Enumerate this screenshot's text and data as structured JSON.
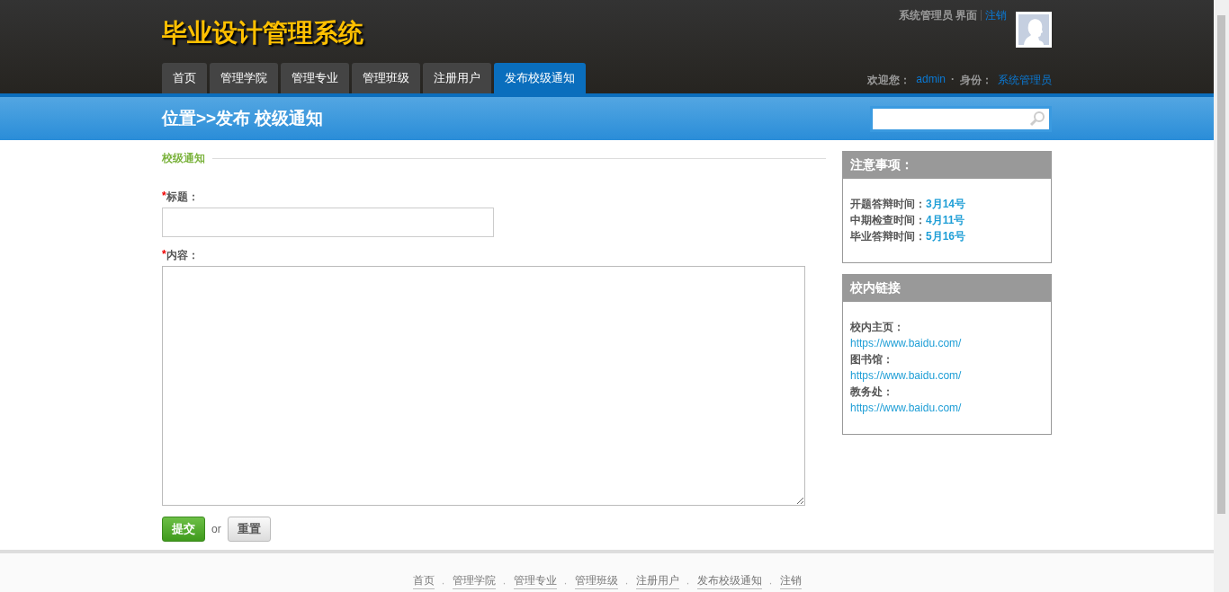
{
  "header": {
    "title": "毕业设计管理系统",
    "role_text": "系统管理员 界面",
    "logout": "注销",
    "welcome_label": "欢迎您：",
    "username": "admin",
    "separator": "·",
    "identity_label": "身份：",
    "identity_value": "系统管理员"
  },
  "nav_tabs": [
    {
      "label": "首页",
      "selected": false
    },
    {
      "label": "管理学院",
      "selected": false
    },
    {
      "label": "管理专业",
      "selected": false
    },
    {
      "label": "管理班级",
      "selected": false
    },
    {
      "label": "注册用户",
      "selected": false
    },
    {
      "label": "发布校级通知",
      "selected": true
    }
  ],
  "breadcrumb": "位置>>发布 校级通知",
  "form": {
    "legend": "校级通知",
    "fields": [
      {
        "kind": "input",
        "marker": "*",
        "label": "标题："
      },
      {
        "kind": "textarea",
        "marker": "*",
        "label": "内容："
      }
    ],
    "submit": "提交",
    "or": "or",
    "reset": "重置"
  },
  "sidebar": [
    {
      "kind": "inline",
      "title": "注意事项：",
      "items": [
        {
          "label": "开题答辩时间：",
          "value": "3月14号"
        },
        {
          "label": "中期检查时间：",
          "value": "4月11号"
        },
        {
          "label": "毕业答辩时间：",
          "value": "5月16号"
        }
      ]
    },
    {
      "kind": "stacked",
      "title": "校内链接",
      "items": [
        {
          "label": "校内主页：",
          "value": "https://www.baidu.com/"
        },
        {
          "label": "图书馆：",
          "value": "https://www.baidu.com/"
        },
        {
          "label": "教务处：",
          "value": "https://www.baidu.com/"
        }
      ]
    }
  ],
  "footer": {
    "separator": "·",
    "links": [
      "首页",
      "管理学院",
      "管理专业",
      "管理班级",
      "注册用户",
      "发布校级通知",
      "注销"
    ]
  }
}
